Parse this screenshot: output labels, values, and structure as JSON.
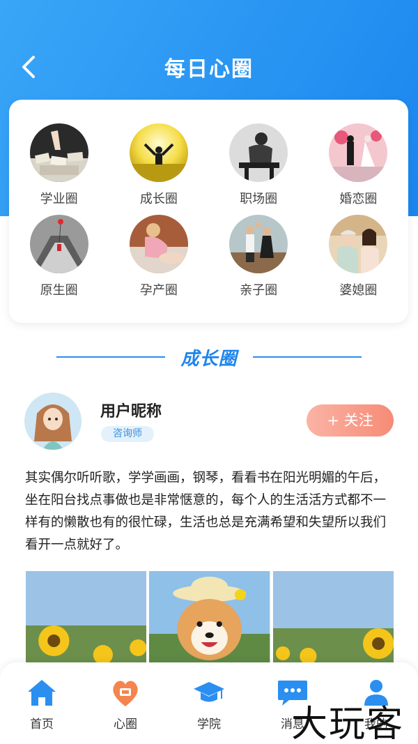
{
  "header": {
    "title": "每日心圈",
    "back_icon": "chevron-left-icon"
  },
  "circles": [
    {
      "label": "学业圈",
      "icon": "books-image"
    },
    {
      "label": "成长圈",
      "icon": "sunrise-person-image"
    },
    {
      "label": "职场圈",
      "icon": "stressed-worker-image"
    },
    {
      "label": "婚恋圈",
      "icon": "wedding-figurines-image"
    },
    {
      "label": "原生圈",
      "icon": "girl-balloon-image"
    },
    {
      "label": "孕产圈",
      "icon": "pregnant-woman-image"
    },
    {
      "label": "亲子圈",
      "icon": "family-image"
    },
    {
      "label": "婆媳圈",
      "icon": "mother-daughter-in-law-image"
    }
  ],
  "section": {
    "title": "成长圈"
  },
  "post": {
    "nickname": "用户昵称",
    "role": "咨询师",
    "follow_label": "+ 关注",
    "content": "其实偶尔听听歌，学学画画，钢琴，看看书在阳光明媚的午后，坐在阳台找点事做也是非常惬意的，每个人的生活活方式都不一样有的懒散也有的很忙碌，生活也总是充满希望和失望所以我们看开一点就好了。",
    "photos": [
      "sunflower-photo",
      "shiba-dog-photo",
      "sunflower-photo"
    ]
  },
  "tabs": [
    {
      "label": "首页",
      "icon": "home-icon"
    },
    {
      "label": "心圈",
      "icon": "heart-chat-icon"
    },
    {
      "label": "学院",
      "icon": "graduation-cap-icon"
    },
    {
      "label": "消息",
      "icon": "message-bubble-icon"
    },
    {
      "label": "我的",
      "icon": "user-icon"
    }
  ],
  "watermark": "大玩客",
  "colors": {
    "primary": "#1a86ee",
    "accent": "#f68b76",
    "badge_bg": "#e3f1fc"
  }
}
